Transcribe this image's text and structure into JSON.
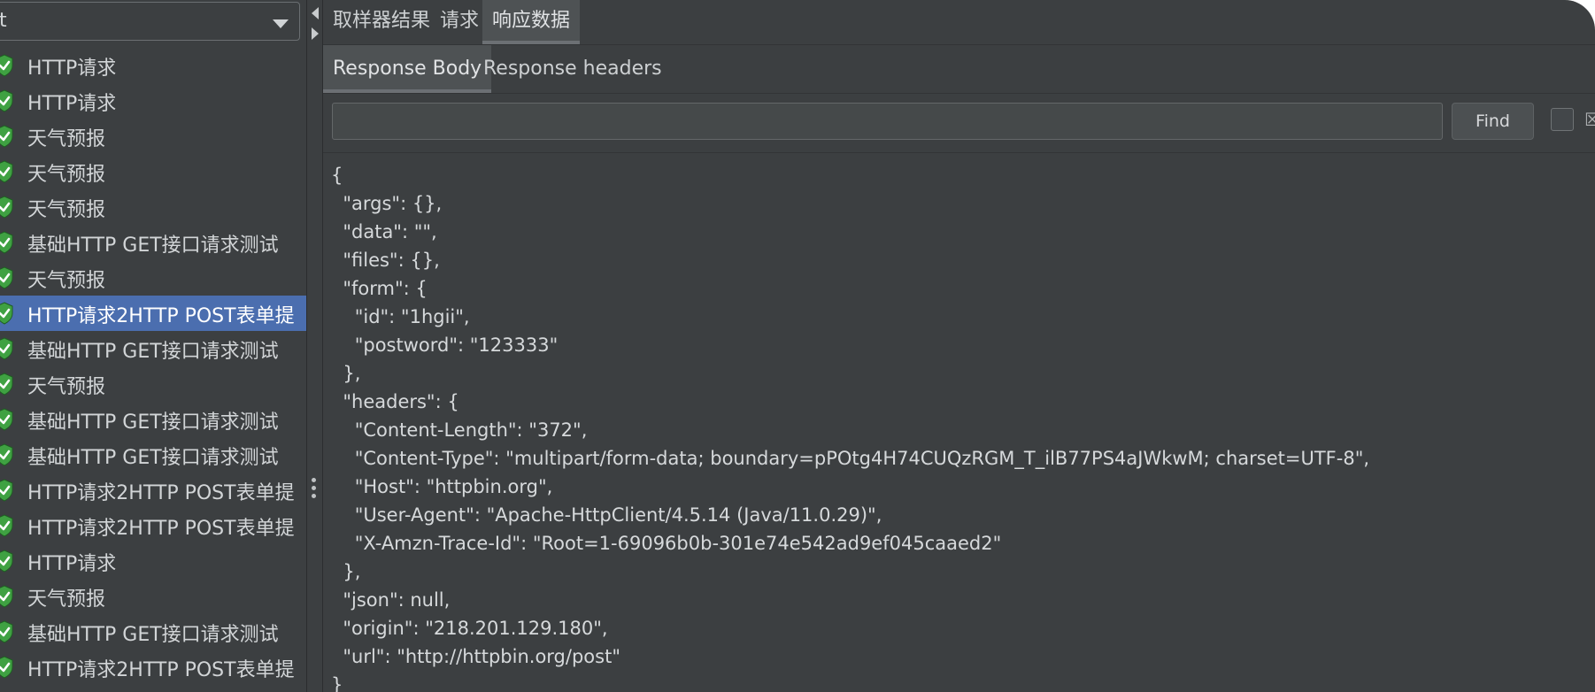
{
  "sidebar": {
    "filter_combo_value": "t",
    "items": [
      {
        "label": "HTTP请求",
        "selected": false
      },
      {
        "label": "HTTP请求",
        "selected": false
      },
      {
        "label": "天气预报",
        "selected": false
      },
      {
        "label": "天气预报",
        "selected": false
      },
      {
        "label": "天气预报",
        "selected": false
      },
      {
        "label": "基础HTTP GET接口请求测试",
        "selected": false
      },
      {
        "label": "天气预报",
        "selected": false
      },
      {
        "label": "HTTP请求2HTTP POST表单提",
        "selected": true
      },
      {
        "label": "基础HTTP GET接口请求测试",
        "selected": false
      },
      {
        "label": "天气预报",
        "selected": false
      },
      {
        "label": "基础HTTP GET接口请求测试",
        "selected": false
      },
      {
        "label": "基础HTTP GET接口请求测试",
        "selected": false
      },
      {
        "label": "HTTP请求2HTTP POST表单提",
        "selected": false
      },
      {
        "label": "HTTP请求2HTTP POST表单提",
        "selected": false
      },
      {
        "label": "HTTP请求",
        "selected": false
      },
      {
        "label": "天气预报",
        "selected": false
      },
      {
        "label": "基础HTTP GET接口请求测试",
        "selected": false
      },
      {
        "label": "HTTP请求2HTTP POST表单提",
        "selected": false
      }
    ],
    "status_icon": "success-shield-icon",
    "status_color": "#3fa142"
  },
  "main": {
    "tabs": [
      {
        "label": "取样器结果",
        "active": false
      },
      {
        "label": "请求",
        "active": false
      },
      {
        "label": "响应数据",
        "active": true
      }
    ],
    "subtabs": [
      {
        "label": "Response Body",
        "active": true
      },
      {
        "label": "Response headers",
        "active": false
      }
    ],
    "search": {
      "value": "",
      "placeholder": ""
    },
    "find_label": "Find",
    "cut_label": "☒",
    "response_body": "{\n  \"args\": {},\n  \"data\": \"\",\n  \"files\": {},\n  \"form\": {\n    \"id\": \"1hgii\",\n    \"postword\": \"123333\"\n  },\n  \"headers\": {\n    \"Content-Length\": \"372\",\n    \"Content-Type\": \"multipart/form-data; boundary=pPOtg4H74CUQzRGM_T_ilB77PS4aJWkwM; charset=UTF-8\",\n    \"Host\": \"httpbin.org\",\n    \"User-Agent\": \"Apache-HttpClient/4.5.14 (Java/11.0.29)\",\n    \"X-Amzn-Trace-Id\": \"Root=1-69096b0b-301e74e542ad9ef045caaed2\"\n  },\n  \"json\": null,\n  \"origin\": \"218.201.129.180\",\n  \"url\": \"http://httpbin.org/post\"\n}"
  },
  "colors": {
    "background": "#3c3f41",
    "selection": "#4b6eaf",
    "active_tab": "#4e5254"
  }
}
